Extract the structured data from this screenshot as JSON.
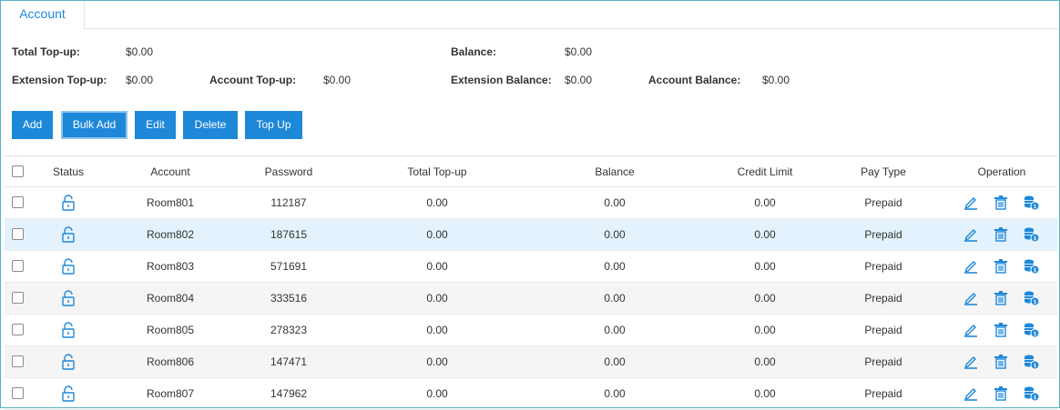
{
  "tab": {
    "label": "Account"
  },
  "summary": {
    "total_topup": {
      "label": "Total Top-up:",
      "value": "$0.00"
    },
    "balance": {
      "label": "Balance:",
      "value": "$0.00"
    },
    "extension_topup": {
      "label": "Extension Top-up:",
      "value": "$0.00"
    },
    "account_topup": {
      "label": "Account Top-up:",
      "value": "$0.00"
    },
    "extension_balance": {
      "label": "Extension Balance:",
      "value": "$0.00"
    },
    "account_balance": {
      "label": "Account Balance:",
      "value": "$0.00"
    }
  },
  "toolbar": {
    "add": "Add",
    "bulk_add": "Bulk Add",
    "edit": "Edit",
    "delete": "Delete",
    "top_up": "Top Up"
  },
  "table": {
    "headers": {
      "status": "Status",
      "account": "Account",
      "password": "Password",
      "total_topup": "Total Top-up",
      "balance": "Balance",
      "credit_limit": "Credit Limit",
      "pay_type": "Pay Type",
      "operation": "Operation"
    },
    "rows": [
      {
        "account": "Room801",
        "password": "112187",
        "total_topup": "0.00",
        "balance": "0.00",
        "credit_limit": "0.00",
        "pay_type": "Prepaid"
      },
      {
        "account": "Room802",
        "password": "187615",
        "total_topup": "0.00",
        "balance": "0.00",
        "credit_limit": "0.00",
        "pay_type": "Prepaid"
      },
      {
        "account": "Room803",
        "password": "571691",
        "total_topup": "0.00",
        "balance": "0.00",
        "credit_limit": "0.00",
        "pay_type": "Prepaid"
      },
      {
        "account": "Room804",
        "password": "333516",
        "total_topup": "0.00",
        "balance": "0.00",
        "credit_limit": "0.00",
        "pay_type": "Prepaid"
      },
      {
        "account": "Room805",
        "password": "278323",
        "total_topup": "0.00",
        "balance": "0.00",
        "credit_limit": "0.00",
        "pay_type": "Prepaid"
      },
      {
        "account": "Room806",
        "password": "147471",
        "total_topup": "0.00",
        "balance": "0.00",
        "credit_limit": "0.00",
        "pay_type": "Prepaid"
      },
      {
        "account": "Room807",
        "password": "147962",
        "total_topup": "0.00",
        "balance": "0.00",
        "credit_limit": "0.00",
        "pay_type": "Prepaid"
      }
    ]
  },
  "icons": {
    "status": "unlock-icon",
    "edit": "pencil-icon",
    "delete": "trash-icon",
    "topup": "coins-icon"
  },
  "colors": {
    "accent": "#1e88d8",
    "highlight_row": "#e3f2fc",
    "striped_row": "#f5f5f5"
  }
}
